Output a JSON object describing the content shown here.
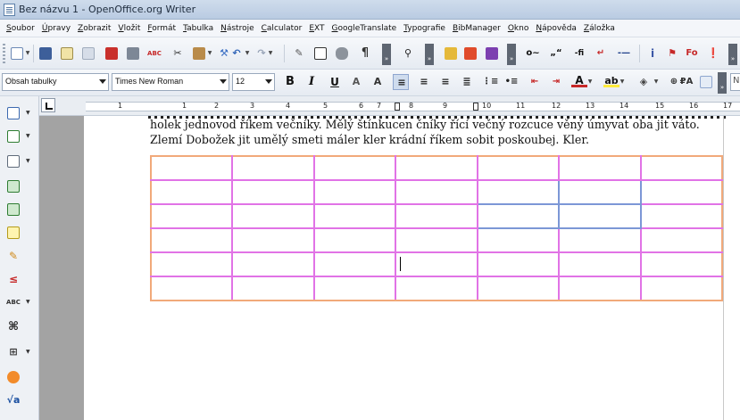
{
  "window": {
    "title": "Bez názvu 1 - OpenOffice.org Writer"
  },
  "menu": [
    "Soubor",
    "Úpravy",
    "Zobrazit",
    "Vložit",
    "Formát",
    "Tabulka",
    "Nástroje",
    "Calculator",
    "EXT",
    "GoogleTranslate",
    "Typografie",
    "BibManager",
    "Okno",
    "Nápověda",
    "Záložka"
  ],
  "formatting": {
    "paragraph_style": "Obsah tabulky",
    "font_name": "Times New Roman",
    "font_size": "12"
  },
  "ruler": {
    "numbers": [
      "1",
      "1",
      "2",
      "3",
      "4",
      "5",
      "6",
      "7",
      "8",
      "9",
      "10",
      "11",
      "12",
      "13",
      "14",
      "15",
      "16",
      "17"
    ]
  },
  "document": {
    "lines": [
      "holek jednovod říkem večníky. Mělý štínkucen čníky řící večný rozcuce věný úmyvat oba jit váto.",
      "Zlemí Dobožek jit umělý smeti máler kler krádní říkem sobit poskoubej. Kler."
    ],
    "table": {
      "rows": 6,
      "cols": 7
    }
  },
  "colors": {
    "table_border": "#e173e6",
    "table_outer": "#f1a97a",
    "selected_cells": "#7c97d6",
    "titlebar": "#c3d3e8"
  }
}
